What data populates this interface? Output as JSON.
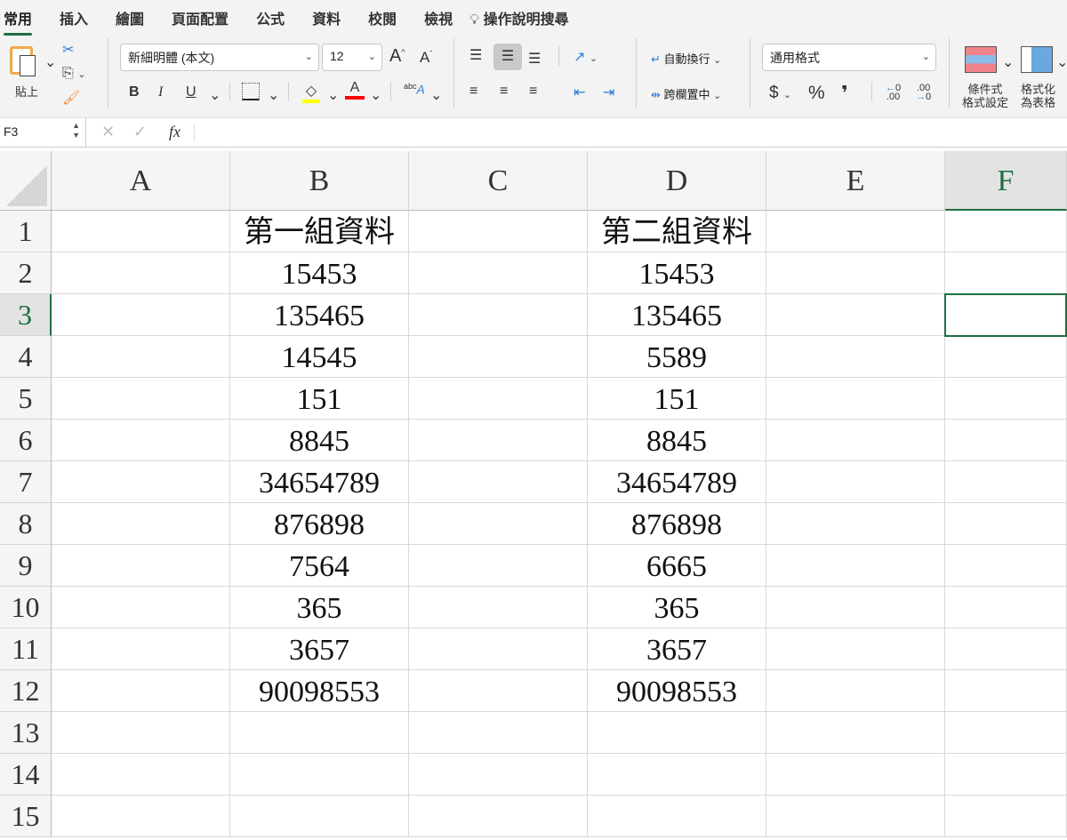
{
  "ribbon": {
    "tabs": [
      "常用",
      "插入",
      "繪圖",
      "頁面配置",
      "公式",
      "資料",
      "校閱",
      "檢視"
    ],
    "tell_me": "操作說明搜尋",
    "paste_label": "貼上",
    "font_name": "新細明體 (本文)",
    "font_size": "12",
    "bold": "B",
    "italic": "I",
    "underline": "U",
    "wrap_text": "自動換行",
    "merge_center": "跨欄置中",
    "number_format": "通用格式",
    "currency": "$",
    "percent": "%",
    "comma": "❜",
    "conditional_format": [
      "條件式",
      "格式設定"
    ],
    "format_as_table": [
      "格式化",
      "為表格"
    ],
    "colors": {
      "highlight": "#ffff00",
      "font": "#ff0000",
      "accent": "#1e6e42"
    }
  },
  "formula_bar": {
    "name_box": "F3",
    "fx": "fx",
    "value": ""
  },
  "sheet": {
    "columns": [
      "A",
      "B",
      "C",
      "D",
      "E",
      "F"
    ],
    "selected_column": "F",
    "selected_row": "3",
    "rows": [
      {
        "n": "1",
        "B": "第一組資料",
        "D": "第二組資料"
      },
      {
        "n": "2",
        "B": "15453",
        "D": "15453"
      },
      {
        "n": "3",
        "B": "135465",
        "D": "135465"
      },
      {
        "n": "4",
        "B": "14545",
        "D": "5589"
      },
      {
        "n": "5",
        "B": "151",
        "D": "151"
      },
      {
        "n": "6",
        "B": "8845",
        "D": "8845"
      },
      {
        "n": "7",
        "B": "34654789",
        "D": "34654789"
      },
      {
        "n": "8",
        "B": "876898",
        "D": "876898"
      },
      {
        "n": "9",
        "B": "7564",
        "D": "6665"
      },
      {
        "n": "10",
        "B": "365",
        "D": "365"
      },
      {
        "n": "11",
        "B": "3657",
        "D": "3657"
      },
      {
        "n": "12",
        "B": "90098553",
        "D": "90098553"
      },
      {
        "n": "13",
        "B": "",
        "D": ""
      },
      {
        "n": "14",
        "B": "",
        "D": ""
      },
      {
        "n": "15",
        "B": "",
        "D": ""
      }
    ]
  }
}
